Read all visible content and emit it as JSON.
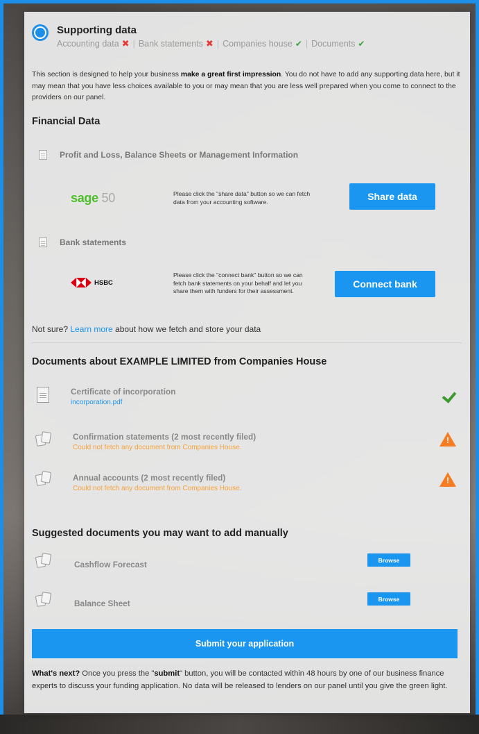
{
  "section": {
    "title": "Supporting data",
    "crumbs": [
      {
        "label": "Accounting data",
        "status": "missing"
      },
      {
        "label": "Bank statements",
        "status": "missing"
      },
      {
        "label": "Companies house",
        "status": "done"
      },
      {
        "label": "Documents",
        "status": "done"
      }
    ],
    "crumb_separator": "|",
    "status_icons": {
      "missing": "✖",
      "done": "✔"
    }
  },
  "intro": {
    "before": "This section is designed to help your business ",
    "bold": "make a great first impression",
    "after": ". You do not have to add any supporting data here, but it may mean that you have less choices available to you or may mean that you are less well prepared when you come to connect to the providers on our panel."
  },
  "financial": {
    "heading": "Financial Data",
    "accounting": {
      "title": "Profit and Loss, Balance Sheets or Management Information",
      "provider_brand": "sage",
      "provider_suffix": "50",
      "hint": "Please click the \"share data\" button so we can fetch data from your accounting software.",
      "button": "Share data"
    },
    "bank": {
      "title": "Bank statements",
      "provider": "HSBC",
      "hint": "Please click the \"connect bank\" button so we can fetch bank statements on your behalf and let you share them with funders for their assessment.",
      "button": "Connect bank"
    },
    "not_sure": {
      "prefix": "Not sure? ",
      "link": "Learn more",
      "suffix": " about how we fetch and store your data"
    }
  },
  "companies_house": {
    "heading": "Documents about EXAMPLE LIMITED from Companies House",
    "items": [
      {
        "title": "Certificate of incorporation",
        "sub": "incorporation.pdf"
      },
      {
        "title": "Confirmation statements (2 most recently filed)",
        "sub": "Could not fetch any document from Companies House."
      },
      {
        "title": "Annual accounts (2 most recently filed)",
        "sub": "Could not fetch any document from Companies House."
      }
    ],
    "warn_symbol": "!"
  },
  "suggested": {
    "heading": "Suggested documents you may want to add manually",
    "items": [
      {
        "title": "Cashflow Forecast",
        "button": "Browse"
      },
      {
        "title": "Balance Sheet",
        "button": "Browse"
      }
    ]
  },
  "submit_button": "Submit your application",
  "whats_next": {
    "bold": "What's next?",
    "text1": " Once you press the \"",
    "bold2": "submit",
    "text2": "\" button, you will be contacted within 48 hours by one of our business finance experts to discuss your funding application. No data will be released to lenders on our panel until you give the green light."
  },
  "colors": {
    "accent": "#1a96f0",
    "error": "#e53935",
    "success": "#3c9a2f",
    "warning": "#f57c23"
  }
}
